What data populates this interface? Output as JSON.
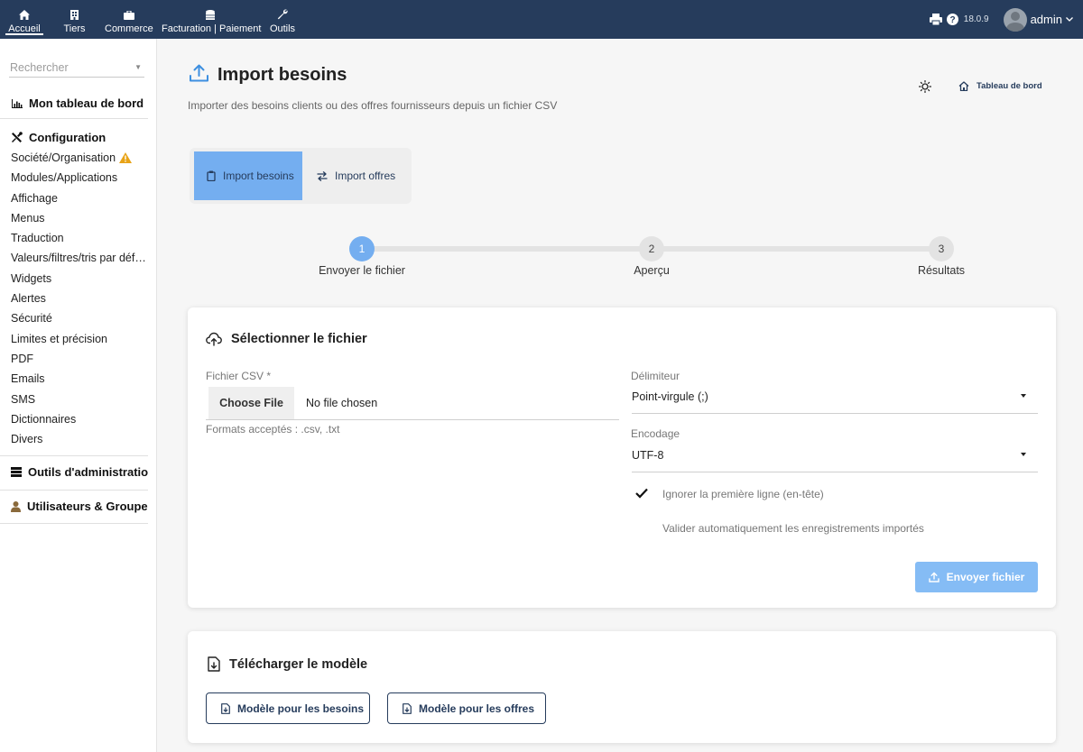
{
  "topnav": [
    {
      "label": "Accueil",
      "icon": "home-icon"
    },
    {
      "label": "Tiers",
      "icon": "building-icon"
    },
    {
      "label": "Commerce",
      "icon": "briefcase-icon"
    },
    {
      "label": "Facturation | Paiement",
      "icon": "coins-icon"
    },
    {
      "label": "Outils",
      "icon": "wrench-icon"
    }
  ],
  "topright": {
    "version": "18.0.9",
    "user": "admin"
  },
  "sidebar": {
    "search_placeholder": "Rechercher",
    "dashboard_label": "Mon tableau de bord",
    "config_label": "Configuration",
    "config_items": [
      "Société/Organisation",
      "Modules/Applications",
      "Affichage",
      "Menus",
      "Traduction",
      "Valeurs/filtres/tris par défaut",
      "Widgets",
      "Alertes",
      "Sécurité",
      "Limites et précision",
      "PDF",
      "Emails",
      "SMS",
      "Dictionnaires",
      "Divers"
    ],
    "admin_tools_label": "Outils d'administration",
    "users_label": "Utilisateurs & Groupes"
  },
  "page": {
    "title": "Import besoins",
    "subtitle": "Importer des besoins clients ou des offres fournisseurs depuis un fichier CSV",
    "dashboard_link": "Tableau de bord"
  },
  "tabs": [
    {
      "label": "Import besoins",
      "active": true
    },
    {
      "label": "Import offres",
      "active": false
    }
  ],
  "steps": [
    {
      "number": "1",
      "label": "Envoyer le fichier",
      "active": true
    },
    {
      "number": "2",
      "label": "Aperçu",
      "active": false
    },
    {
      "number": "3",
      "label": "Résultats",
      "active": false
    }
  ],
  "upload": {
    "title": "Sélectionner le fichier",
    "file_label": "Fichier CSV *",
    "choose_label": "Choose File",
    "no_file": "No file chosen",
    "formats_hint": "Formats acceptés : .csv, .txt",
    "delimiter_label": "Délimiteur",
    "delimiter_value": "Point-virgule (;)",
    "encoding_label": "Encodage",
    "encoding_value": "UTF-8",
    "skip_header_label": "Ignorer la première ligne (en-tête)",
    "skip_header_checked": true,
    "auto_validate_label": "Valider automatiquement les enregistrements importés",
    "auto_validate_checked": false,
    "send_label": "Envoyer fichier"
  },
  "template": {
    "title": "Télécharger le modèle",
    "needs_button": "Modèle pour les besoins",
    "offers_button": "Modèle pour les offres"
  },
  "colors": {
    "topbar": "#263c5c",
    "accent": "#74aef0",
    "send_button": "#85bcf5",
    "warning": "#e8a317"
  }
}
